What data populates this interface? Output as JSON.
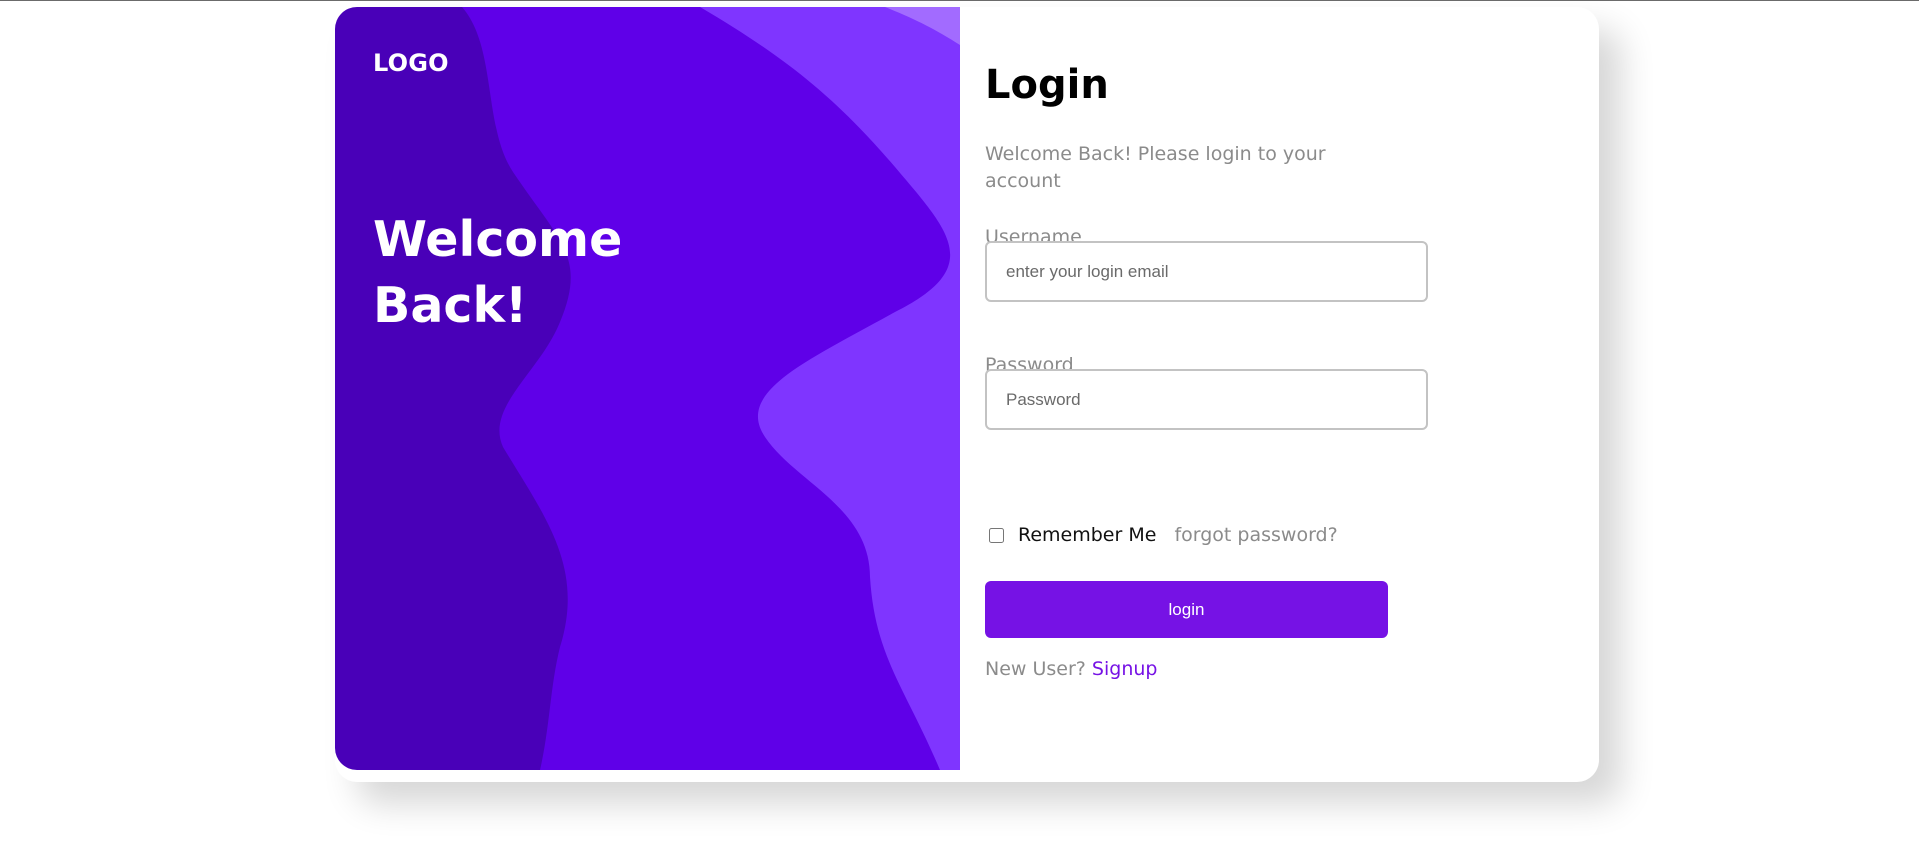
{
  "brand": {
    "logo_text": "LOGO",
    "hero_title": "Welcome Back!",
    "colors": {
      "hero_dark": "#4900b8",
      "hero_mid": "#5f00e8",
      "hero_light": "#7f35ff",
      "accent": "#7612e5"
    }
  },
  "form": {
    "title": "Login",
    "subtitle": "Welcome Back! Please login to your account",
    "username": {
      "label": "Username",
      "value": "",
      "placeholder": "enter your login email"
    },
    "password": {
      "label": "Password",
      "value": "",
      "placeholder": "Password"
    },
    "remember_label": "Remember Me",
    "remember_checked": false,
    "forgot_label": "forgot password?",
    "login_label": "login",
    "signup_prompt": "New User?",
    "signup_label": "Signup"
  }
}
